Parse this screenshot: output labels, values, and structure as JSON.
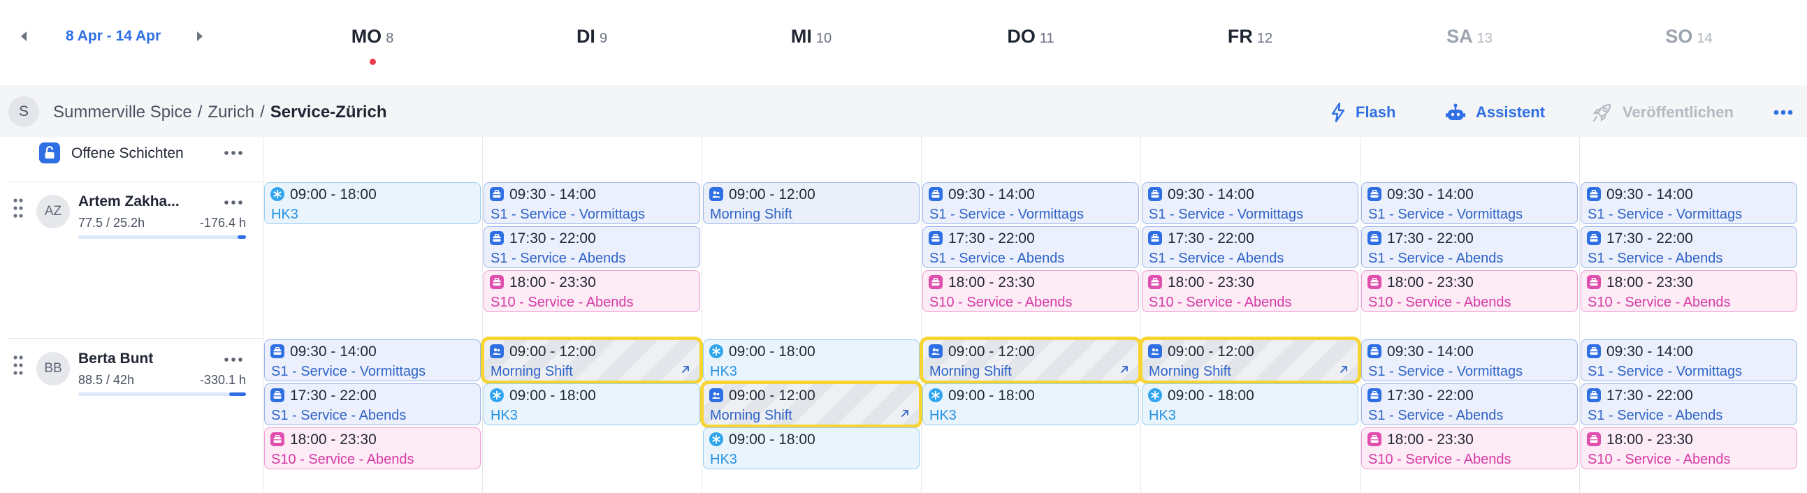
{
  "header": {
    "prev_icon": "chevron-left-icon",
    "next_icon": "chevron-right-icon",
    "date_range": "8 Apr - 14 Apr",
    "days": [
      {
        "name": "MO",
        "num": "8",
        "today": true,
        "weekend": false
      },
      {
        "name": "DI",
        "num": "9",
        "today": false,
        "weekend": false
      },
      {
        "name": "MI",
        "num": "10",
        "today": false,
        "weekend": false
      },
      {
        "name": "DO",
        "num": "11",
        "today": false,
        "weekend": false
      },
      {
        "name": "FR",
        "num": "12",
        "today": false,
        "weekend": false
      },
      {
        "name": "SA",
        "num": "13",
        "today": false,
        "weekend": true
      },
      {
        "name": "SO",
        "num": "14",
        "today": false,
        "weekend": true
      }
    ]
  },
  "breadcrumb": {
    "avatar": "S",
    "parts": [
      "Summerville Spice",
      "Zurich"
    ],
    "separator": "/",
    "current": "Service-Zürich"
  },
  "actions": {
    "flash": "Flash",
    "assistant": "Assistent",
    "publish": "Veröffentlichen",
    "more_icon": "more-horizontal-icon"
  },
  "open_shifts": {
    "label": "Offene Schichten",
    "icon": "lock-open-icon"
  },
  "employees": [
    {
      "initials": "AZ",
      "name": "Artem Zakha...",
      "hours": "77.5 / 25.2h",
      "balance": "-176.4 h",
      "progress": 0.05,
      "days": [
        [
          {
            "time": "09:00 - 18:00",
            "name": "HK3",
            "type": "hk3"
          }
        ],
        [
          {
            "time": "09:30 - 14:00",
            "name": "S1 - Service - Vormittags",
            "type": "s1"
          },
          {
            "time": "17:30 - 22:00",
            "name": "S1 - Service - Abends",
            "type": "s1"
          },
          {
            "time": "18:00 - 23:30",
            "name": "S10 - Service - Abends",
            "type": "s10"
          }
        ],
        [
          {
            "time": "09:00 - 12:00",
            "name": "Morning Shift",
            "type": "morning"
          }
        ],
        [
          {
            "time": "09:30 - 14:00",
            "name": "S1 - Service - Vormittags",
            "type": "s1"
          },
          {
            "time": "17:30 - 22:00",
            "name": "S1 - Service - Abends",
            "type": "s1"
          },
          {
            "time": "18:00 - 23:30",
            "name": "S10 - Service - Abends",
            "type": "s10"
          }
        ],
        [
          {
            "time": "09:30 - 14:00",
            "name": "S1 - Service - Vormittags",
            "type": "s1"
          },
          {
            "time": "17:30 - 22:00",
            "name": "S1 - Service - Abends",
            "type": "s1"
          },
          {
            "time": "18:00 - 23:30",
            "name": "S10 - Service - Abends",
            "type": "s10"
          }
        ],
        [
          {
            "time": "09:30 - 14:00",
            "name": "S1 - Service - Vormittags",
            "type": "s1"
          },
          {
            "time": "17:30 - 22:00",
            "name": "S1 - Service - Abends",
            "type": "s1"
          },
          {
            "time": "18:00 - 23:30",
            "name": "S10 - Service - Abends",
            "type": "s10"
          }
        ],
        [
          {
            "time": "09:30 - 14:00",
            "name": "S1 - Service - Vormittags",
            "type": "s1"
          },
          {
            "time": "17:30 - 22:00",
            "name": "S1 - Service - Abends",
            "type": "s1"
          },
          {
            "time": "18:00 - 23:30",
            "name": "S10 - Service - Abends",
            "type": "s10"
          }
        ]
      ]
    },
    {
      "initials": "BB",
      "name": "Berta Bunt",
      "hours": "88.5 / 42h",
      "balance": "-330.1 h",
      "progress": 0.1,
      "days": [
        [
          {
            "time": "09:30 - 14:00",
            "name": "S1 - Service - Vormittags",
            "type": "s1"
          },
          {
            "time": "17:30 - 22:00",
            "name": "S1 - Service - Abends",
            "type": "s1"
          },
          {
            "time": "18:00 - 23:30",
            "name": "S10 - Service - Abends",
            "type": "s10"
          }
        ],
        [
          {
            "time": "09:00 - 12:00",
            "name": "Morning Shift",
            "type": "morning",
            "striped": true,
            "highlight": true
          },
          {
            "time": "09:00 - 18:00",
            "name": "HK3",
            "type": "hk3"
          }
        ],
        [
          {
            "time": "09:00 - 18:00",
            "name": "HK3",
            "type": "hk3"
          },
          {
            "time": "09:00 - 12:00",
            "name": "Morning Shift",
            "type": "morning",
            "striped": true,
            "highlight": true
          },
          {
            "time": "09:00 - 18:00",
            "name": "HK3",
            "type": "hk3"
          }
        ],
        [
          {
            "time": "09:00 - 12:00",
            "name": "Morning Shift",
            "type": "morning",
            "striped": true,
            "highlight": true
          },
          {
            "time": "09:00 - 18:00",
            "name": "HK3",
            "type": "hk3"
          }
        ],
        [
          {
            "time": "09:00 - 12:00",
            "name": "Morning Shift",
            "type": "morning",
            "striped": true,
            "highlight": true
          },
          {
            "time": "09:00 - 18:00",
            "name": "HK3",
            "type": "hk3"
          }
        ],
        [
          {
            "time": "09:30 - 14:00",
            "name": "S1 - Service - Vormittags",
            "type": "s1"
          },
          {
            "time": "17:30 - 22:00",
            "name": "S1 - Service - Abends",
            "type": "s1"
          },
          {
            "time": "18:00 - 23:30",
            "name": "S10 - Service - Abends",
            "type": "s10"
          }
        ],
        [
          {
            "time": "09:30 - 14:00",
            "name": "S1 - Service - Vormittags",
            "type": "s1"
          },
          {
            "time": "17:30 - 22:00",
            "name": "S1 - Service - Abends",
            "type": "s1"
          },
          {
            "time": "18:00 - 23:30",
            "name": "S10 - Service - Abends",
            "type": "s10"
          }
        ]
      ]
    }
  ],
  "colors": {
    "accent": "#2f6fe4",
    "highlight": "#f7d430",
    "today_dot": "#ec3b4c",
    "s10": "#d63aa4",
    "hk3": "#2592e0"
  }
}
